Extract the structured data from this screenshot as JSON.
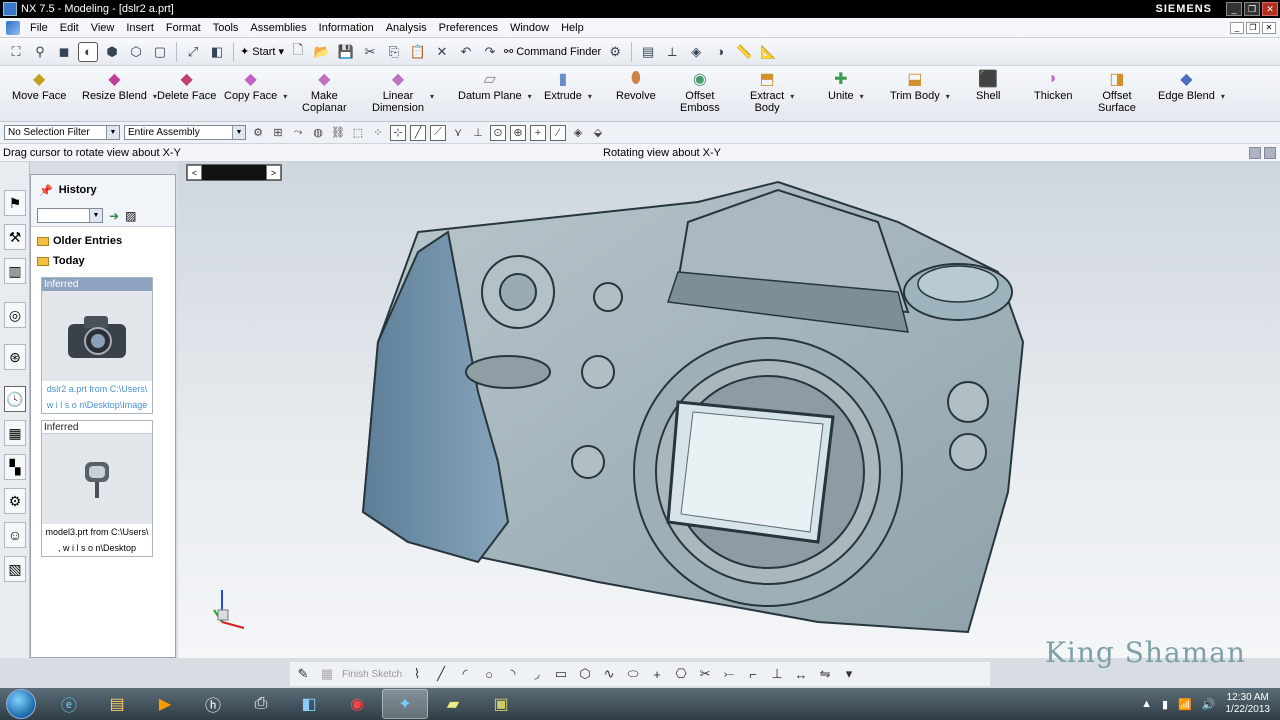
{
  "window": {
    "title": "NX 7.5 - Modeling - [dslr2 a.prt]",
    "brand": "SIEMENS"
  },
  "menu": [
    "File",
    "Edit",
    "View",
    "Insert",
    "Format",
    "Tools",
    "Assemblies",
    "Information",
    "Analysis",
    "Preferences",
    "Window",
    "Help"
  ],
  "toolbar1": {
    "start_label": "Start",
    "command_finder_label": "Command Finder"
  },
  "features": [
    {
      "label": "Move Face",
      "label2": ""
    },
    {
      "label": "Resize Blend",
      "label2": ""
    },
    {
      "label": "Delete Face",
      "label2": ""
    },
    {
      "label": "Copy Face",
      "label2": ""
    },
    {
      "label": "Make",
      "label2": "Coplanar"
    },
    {
      "label": "Linear",
      "label2": "Dimension"
    },
    {
      "label": "Datum Plane",
      "label2": ""
    },
    {
      "label": "Extrude",
      "label2": ""
    },
    {
      "label": "Revolve",
      "label2": ""
    },
    {
      "label": "Offset",
      "label2": "Emboss"
    },
    {
      "label": "Extract",
      "label2": "Body"
    },
    {
      "label": "Unite",
      "label2": ""
    },
    {
      "label": "Trim Body",
      "label2": ""
    },
    {
      "label": "Shell",
      "label2": ""
    },
    {
      "label": "Thicken",
      "label2": ""
    },
    {
      "label": "Offset",
      "label2": "Surface"
    },
    {
      "label": "Edge Blend",
      "label2": ""
    }
  ],
  "selection": {
    "filter": "No Selection Filter",
    "scope": "Entire Assembly"
  },
  "status": {
    "cue": "Drag cursor to rotate view about X-Y",
    "message": "Rotating view about X-Y"
  },
  "navigator": {
    "title": "History",
    "folders": [
      "Older Entries",
      "Today"
    ],
    "entries": [
      {
        "tag": "Inferred",
        "caption1": "dslr2 a.prt from C:\\Users\\",
        "caption2": "w i l s o n\\Desktop\\Image"
      },
      {
        "tag": "Inferred",
        "caption1": "model3.prt from C:\\Users\\",
        "caption2": ", w i l s o n\\Desktop"
      }
    ]
  },
  "sketch": {
    "finish_label": "Finish Sketch"
  },
  "watermark": "King Shaman",
  "clock": {
    "time": "12:30 AM",
    "date": "1/22/2013"
  }
}
